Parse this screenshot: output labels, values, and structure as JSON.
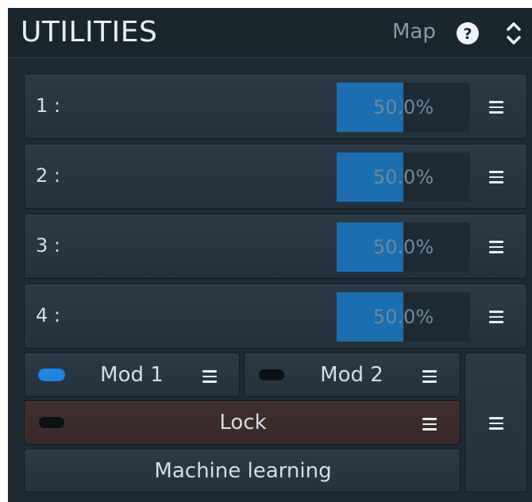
{
  "header": {
    "title": "UTILITIES",
    "map_label": "Map",
    "help_icon": "?"
  },
  "modulators": [
    {
      "label": "1 :",
      "value": "50.0%",
      "fill": 0.5
    },
    {
      "label": "2 :",
      "value": "50.0%",
      "fill": 0.5
    },
    {
      "label": "3 :",
      "value": "50.0%",
      "fill": 0.5
    },
    {
      "label": "4 :",
      "value": "50.0%",
      "fill": 0.5
    }
  ],
  "mod1": {
    "label": "Mod 1",
    "active": true
  },
  "mod2": {
    "label": "Mod 2",
    "active": false
  },
  "lock": {
    "label": "Lock",
    "active": false
  },
  "machine_learning": {
    "label": "Machine learning"
  },
  "colors": {
    "accent": "#1a86e0",
    "bar_fill": "#1b6fb0",
    "panel_bg": "#1d2a33",
    "lock_bg": "#3d2b2b"
  }
}
